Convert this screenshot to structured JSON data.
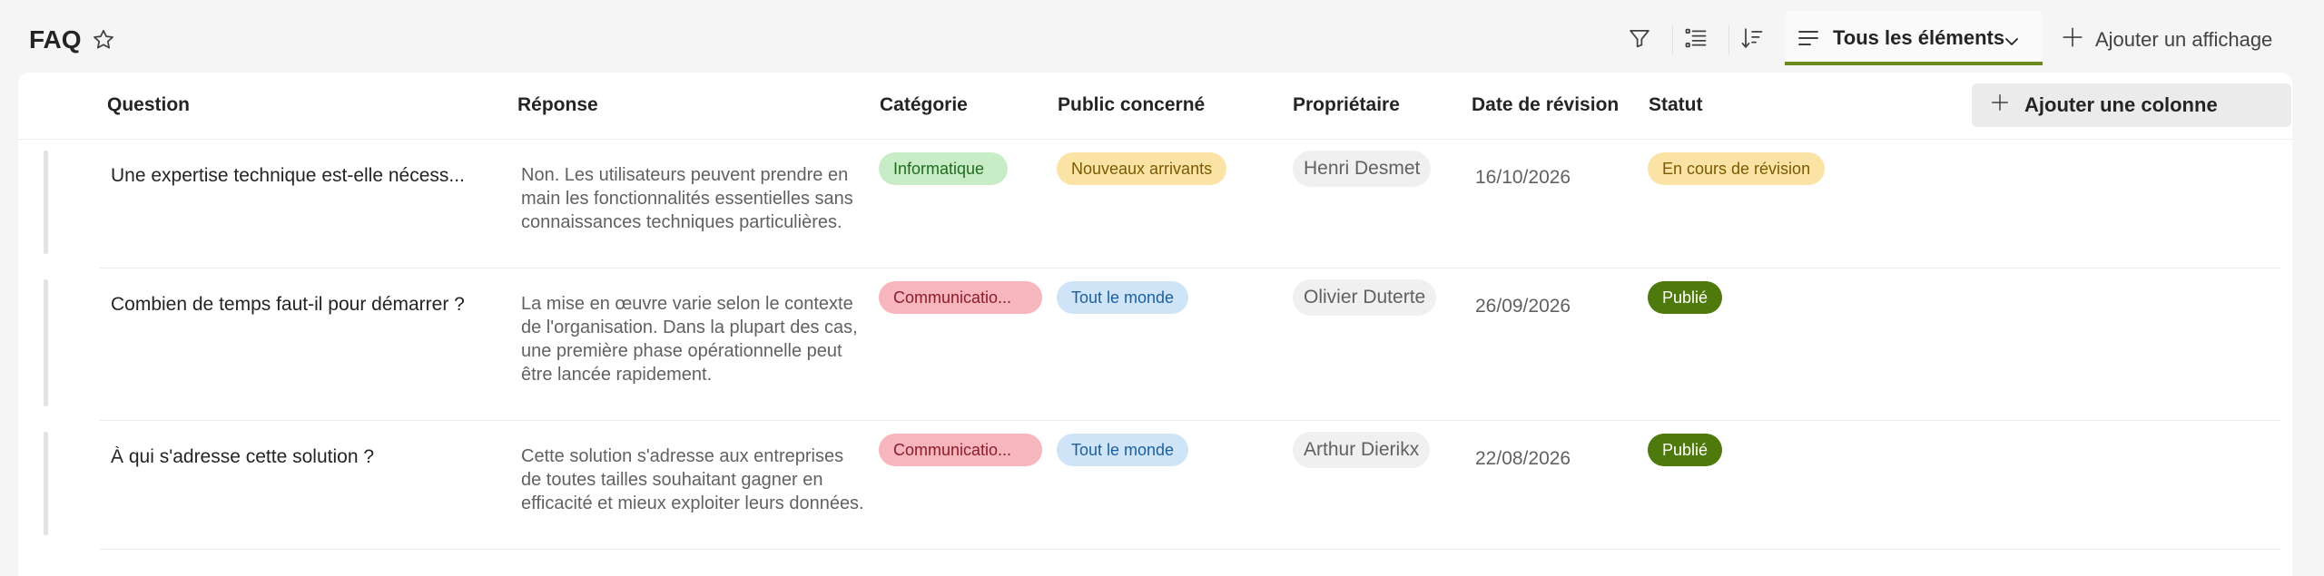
{
  "header": {
    "title": "FAQ",
    "view_label": "Tous les éléments",
    "add_view_label": "Ajouter un affichage"
  },
  "table": {
    "columns": [
      "Question",
      "Réponse",
      "Catégorie",
      "Public concerné",
      "Propriétaire",
      "Date de révision",
      "Statut"
    ],
    "add_column_label": "Ajouter une colonne",
    "rows": [
      {
        "question": "Une expertise technique est-elle nécess...",
        "reponse": "Non. Les utilisateurs peuvent prendre en main les fonctionnalités essentielles sans connaissances techniques particulières.",
        "categorie": "Informatique",
        "public": "Nouveaux arrivants",
        "proprietaire": "Henri Desmet",
        "date": "16/10/2026",
        "statut": "En cours de révision"
      },
      {
        "question": "Combien de temps faut-il pour démarrer ?",
        "reponse": "La mise en œuvre varie selon le contexte de l'organisation. Dans la plupart des cas, une première phase opérationnelle peut être lancée rapidement.",
        "categorie": "Communicatio...",
        "public": "Tout le monde",
        "proprietaire": "Olivier Duterte",
        "date": "26/09/2026",
        "statut": "Publié"
      },
      {
        "question": "À qui s'adresse cette solution ?",
        "reponse": "Cette solution s'adresse aux entreprises de toutes tailles souhaitant gagner en efficacité et mieux exploiter leurs données.",
        "categorie": "Communicatio...",
        "public": "Tout le monde",
        "proprietaire": "Arthur Dierikx",
        "date": "22/08/2026",
        "statut": "Publié"
      }
    ]
  },
  "colors": {
    "accent": "#6b8a1e",
    "pill_informatique_bg": "#c7ecc6",
    "pill_communication_bg": "#f7b6bd",
    "pill_nouveaux_bg": "#fbe3a6",
    "pill_toutlemonde_bg": "#cfe4f7",
    "status_review_bg": "#fbe3a6",
    "status_published_bg": "#4e7a0c"
  },
  "icons": [
    "star-icon",
    "filter-icon",
    "list-view-icon",
    "sort-icon",
    "view-lines-icon",
    "chevron-down-icon",
    "plus-icon"
  ]
}
